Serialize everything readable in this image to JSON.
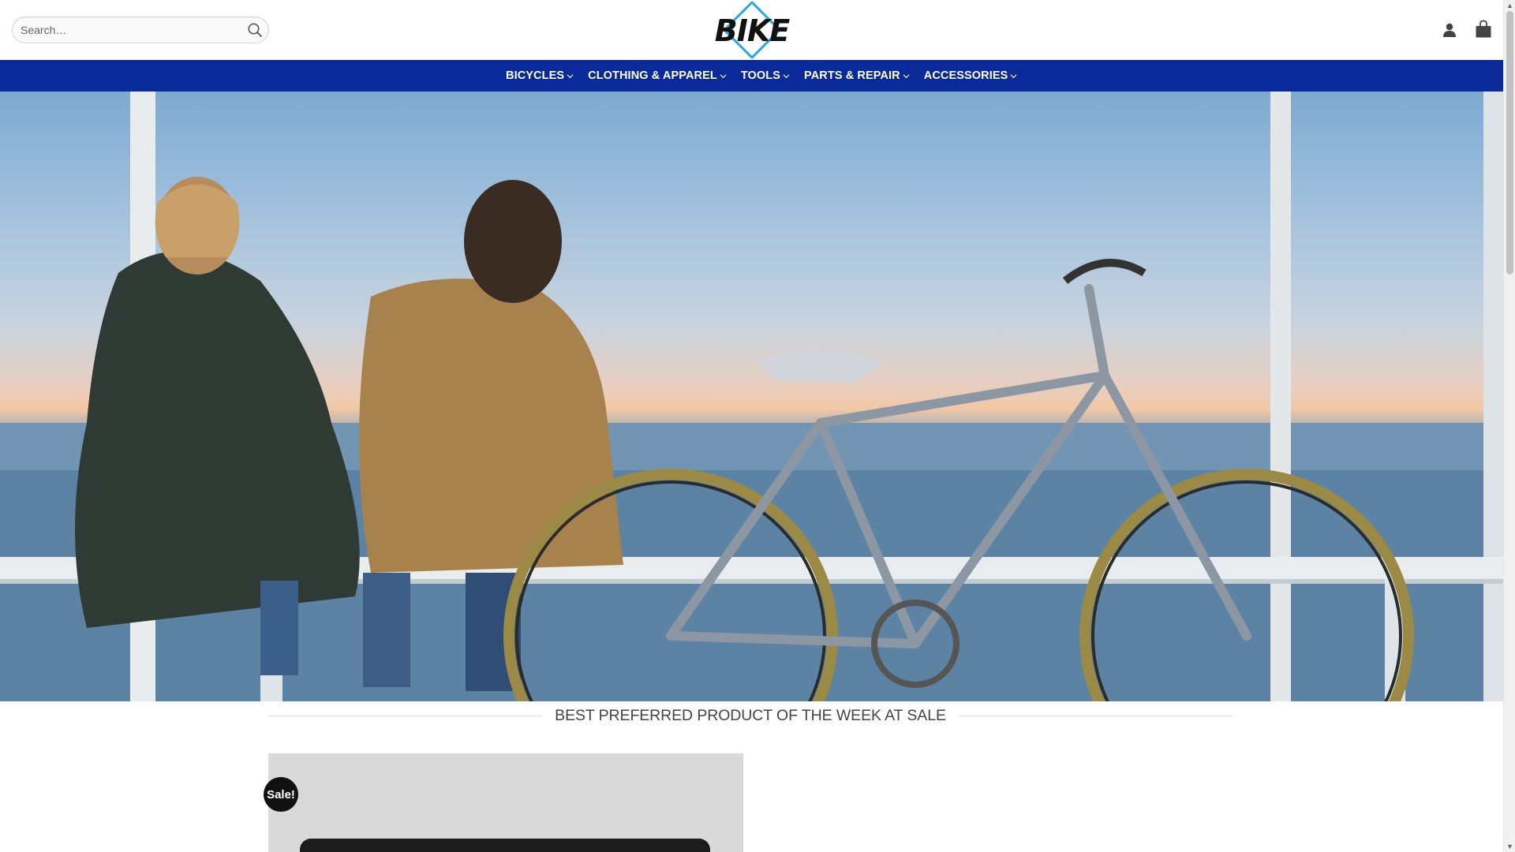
{
  "header": {
    "search": {
      "placeholder": "Search…"
    },
    "logo_text": "BIKE"
  },
  "nav": {
    "items": [
      {
        "label": "BICYCLES"
      },
      {
        "label": "CLOTHING & APPAREL"
      },
      {
        "label": "TOOLS"
      },
      {
        "label": "PARTS & REPAIR"
      },
      {
        "label": "ACCESSORIES"
      }
    ]
  },
  "hero": {
    "image": "couple sitting on pier railing next to bicycle at sunset over sea"
  },
  "section": {
    "title": "BEST PREFERRED PRODUCT OF THE WEEK AT SALE"
  },
  "product": {
    "badge": "Sale!"
  },
  "colors": {
    "nav_bg": "#0a2a9a",
    "accent": "#29a8e0",
    "badge_bg": "#111111"
  }
}
